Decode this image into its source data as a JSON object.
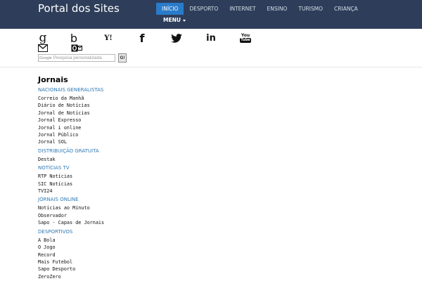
{
  "header": {
    "brand": "Portal dos Sites",
    "nav": [
      "INÍCIO",
      "DESPORTO",
      "INTERNET",
      "ENSINO",
      "TURISMO",
      "CRIANÇA"
    ],
    "menu_label": "MENU"
  },
  "icons": [
    {
      "name": "google-icon",
      "glyph": "g"
    },
    {
      "name": "bing-icon",
      "glyph": "b"
    },
    {
      "name": "yahoo-icon",
      "glyph": "Y!"
    },
    {
      "name": "facebook-icon",
      "glyph": "f"
    },
    {
      "name": "twitter-icon",
      "glyph": "twitter-bird"
    },
    {
      "name": "linkedin-icon",
      "glyph": "in"
    },
    {
      "name": "youtube-icon",
      "glyph": "You Tube"
    },
    {
      "name": "gmail-icon",
      "glyph": "M"
    },
    {
      "name": "outlook-icon",
      "glyph": "O"
    }
  ],
  "search": {
    "logo": "Google",
    "placeholder": "Pesquisa personalizada",
    "button": "G!"
  },
  "content": {
    "title": "Jornais",
    "categories": [
      {
        "title": "NACIONAIS GENERALISTAS",
        "links": [
          "Correio da Manhã",
          "Diário de Notícias",
          "Jornal de Notícias",
          "Jornal Expresso",
          "Jornal i online",
          "Jornal Público",
          "Jornal SOL"
        ]
      },
      {
        "title": "DISTRIBUIÇÃO GRATUITA",
        "links": [
          "Destak"
        ]
      },
      {
        "title": "NOTÍCIAS TV",
        "links": [
          "RTP Notícias",
          "SIC Notícias",
          "TVI24"
        ]
      },
      {
        "title": "JORNAIS ONLINE",
        "links": [
          "Notícias ao Minuto",
          "Observador",
          "Sapo - Capas de Jornais"
        ]
      },
      {
        "title": "DESPORTIVOS",
        "links": [
          "A Bola",
          "O Jogo",
          "Record",
          "Mais Futebol",
          "Sapo Desporto",
          "ZeroZero"
        ]
      }
    ]
  }
}
